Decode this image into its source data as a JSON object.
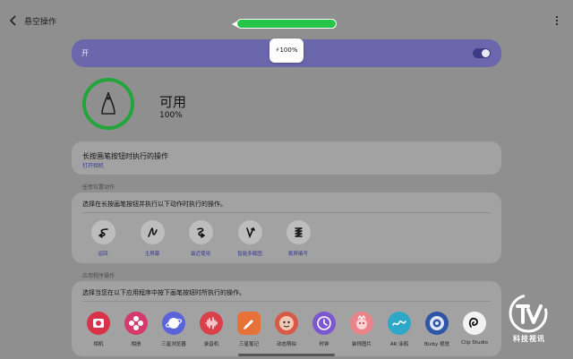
{
  "header": {
    "title": "悬空操作",
    "back_icon": "chevron-left-icon",
    "more_icon": "more-vertical-icon"
  },
  "colors": {
    "accent": "#6a67ad",
    "pen_green": "#26c54a",
    "ring_green": "#22a53b",
    "link": "#3a3a9a"
  },
  "master_switch": {
    "label": "开",
    "on": true
  },
  "battery_popup": {
    "icon": "lightning-icon",
    "text": "100%"
  },
  "pen_status": {
    "title": "可用",
    "battery": "100%",
    "level": 1.0
  },
  "pen_button_action": {
    "title": "长按画笔按钮时执行的操作",
    "value": "打开相机"
  },
  "anywhere_section": {
    "header": "任意位置动作",
    "description": "选择在长按画笔按钮并执行以下动作时执行的操作。",
    "gestures": [
      {
        "label": "返回",
        "icon": "gesture-back-icon"
      },
      {
        "label": "主屏幕",
        "icon": "gesture-home-icon"
      },
      {
        "label": "最近使用",
        "icon": "gesture-recents-icon"
      },
      {
        "label": "智能多截图",
        "icon": "gesture-smart-select-icon"
      },
      {
        "label": "截屏编写",
        "icon": "gesture-screen-write-icon"
      }
    ]
  },
  "app_section": {
    "header": "应用程序操作",
    "description": "选择当您在以下应用程序中按下画笔按钮时所执行的操作。",
    "apps": [
      {
        "label": "相机",
        "icon": "camera-app-icon",
        "color": "#d9334a"
      },
      {
        "label": "相册",
        "icon": "gallery-app-icon",
        "color": "#d43a6a"
      },
      {
        "label": "三星浏览器",
        "icon": "browser-app-icon",
        "color": "#5a63d8"
      },
      {
        "label": "录音机",
        "icon": "voice-recorder-app-icon",
        "color": "#d9404a"
      },
      {
        "label": "三星笔记",
        "icon": "notes-app-icon",
        "color": "#e8713a"
      },
      {
        "label": "动态萌拍",
        "icon": "ar-emoji-app-icon",
        "color": "#d85a46"
      },
      {
        "label": "时钟",
        "icon": "clock-app-icon",
        "color": "#7c58d0"
      },
      {
        "label": "装饰图片",
        "icon": "decorate-pic-app-icon",
        "color": "#e8838a"
      },
      {
        "label": "AR 涂鸦",
        "icon": "ar-doodle-app-icon",
        "color": "#2fa8c8"
      },
      {
        "label": "Bixby 视觉",
        "icon": "bixby-vision-app-icon",
        "color": "#2f55a8"
      },
      {
        "label": "Clip Studio",
        "icon": "clip-studio-app-icon",
        "color": "#f2f2f2"
      }
    ]
  },
  "watermark": {
    "icon": "tv-logo-icon",
    "text": "科技视讯"
  }
}
